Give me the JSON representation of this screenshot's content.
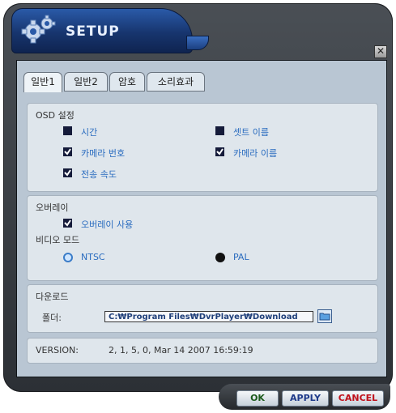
{
  "window": {
    "title": "SETUP",
    "close_glyph": "✕"
  },
  "tabs": [
    {
      "label": "일반1",
      "active": true
    },
    {
      "label": "일반2",
      "active": false
    },
    {
      "label": "암호",
      "active": false
    },
    {
      "label": "소리효과",
      "active": false
    }
  ],
  "osd": {
    "title": "OSD 설정",
    "items": [
      {
        "label": "시간",
        "checked": false
      },
      {
        "label": "셋트 이름",
        "checked": false
      },
      {
        "label": "카메라 번호",
        "checked": true
      },
      {
        "label": "카메라 이름",
        "checked": true
      },
      {
        "label": "전송 속도",
        "checked": true
      }
    ]
  },
  "overlay": {
    "title": "오버레이",
    "use_label": "오버레이 사용",
    "use_checked": true,
    "video_mode_title": "비디오 모드",
    "modes": [
      {
        "label": "NTSC",
        "selected": true
      },
      {
        "label": "PAL",
        "selected": false
      }
    ]
  },
  "download": {
    "title": "다운로드",
    "folder_label": "폴더:",
    "folder_value": "C:₩Program Files₩DvrPlayer₩Download"
  },
  "version": {
    "label": "VERSION:",
    "value": "2, 1, 5, 0,  Mar 14 2007  16:59:19"
  },
  "buttons": {
    "ok": "OK",
    "apply": "APPLY",
    "cancel": "CANCEL"
  },
  "colors": {
    "title_blue": "#17356e",
    "label_blue": "#2a6cbf",
    "cancel_red": "#c0101a",
    "apply_blue": "#1e3a8a"
  }
}
